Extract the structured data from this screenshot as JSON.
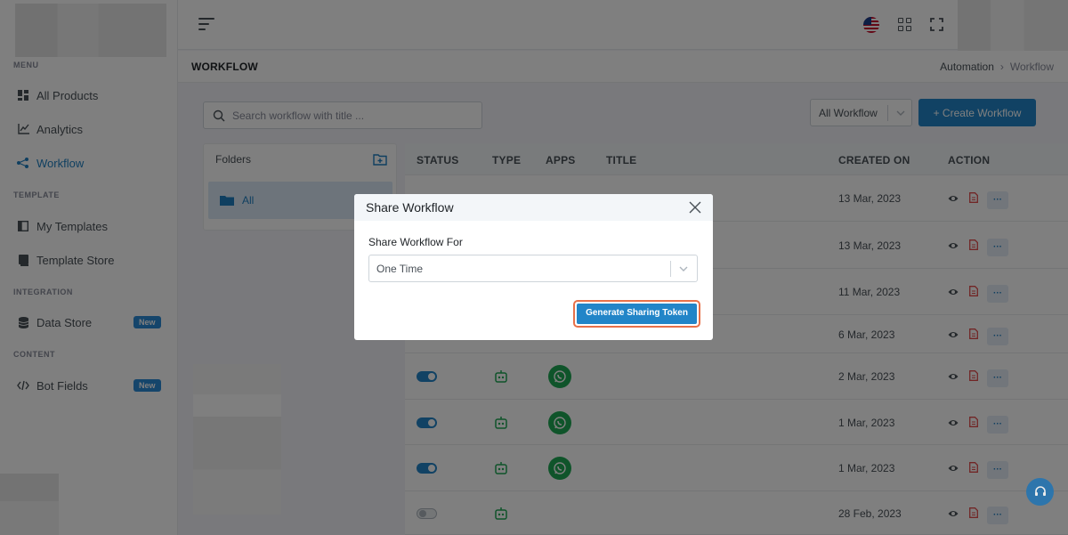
{
  "sidebar": {
    "sections": [
      {
        "title": "MENU"
      },
      {
        "title": "TEMPLATE"
      },
      {
        "title": "INTEGRATION"
      },
      {
        "title": "CONTENT"
      }
    ],
    "items": [
      {
        "label": "All Products",
        "icon": "dashboard-icon"
      },
      {
        "label": "Analytics",
        "icon": "line-chart-icon"
      },
      {
        "label": "Workflow",
        "icon": "share-nodes-icon",
        "active": true
      },
      {
        "label": "My Templates",
        "icon": "template-icon"
      },
      {
        "label": "Template Store",
        "icon": "book-icon"
      },
      {
        "label": "Data Store",
        "icon": "database-icon",
        "badge": "New"
      },
      {
        "label": "Bot Fields",
        "icon": "code-icon",
        "badge": "New"
      }
    ]
  },
  "header": {
    "page_title": "WORKFLOW",
    "breadcrumb": [
      "Automation",
      "Workflow"
    ]
  },
  "toolbar": {
    "search_placeholder": "Search workflow with title ...",
    "filter_value": "All Workflow",
    "create_label": "+ Create Workflow"
  },
  "folders": {
    "title": "Folders",
    "items": [
      "All"
    ]
  },
  "table": {
    "columns": [
      "STATUS",
      "TYPE",
      "APPS",
      "TITLE",
      "CREATED ON",
      "ACTION"
    ],
    "rows": [
      {
        "created_on": "13 Mar, 2023"
      },
      {
        "created_on": "13 Mar, 2023"
      },
      {
        "created_on": "11 Mar, 2023"
      },
      {
        "created_on": "6 Mar, 2023"
      },
      {
        "created_on": "2 Mar, 2023",
        "status": "on"
      },
      {
        "created_on": "1 Mar, 2023",
        "status": "on"
      },
      {
        "created_on": "1 Mar, 2023",
        "status": "on"
      },
      {
        "created_on": "28 Feb, 2023",
        "status": "off"
      }
    ],
    "more_label": "···"
  },
  "modal": {
    "title": "Share Workflow",
    "field_label": "Share Workflow For",
    "field_value": "One Time",
    "button_label": "Generate Sharing Token"
  },
  "colors": {
    "accent": "#2285c8",
    "highlight_border": "#e8714a",
    "whatsapp": "#1fa855"
  }
}
